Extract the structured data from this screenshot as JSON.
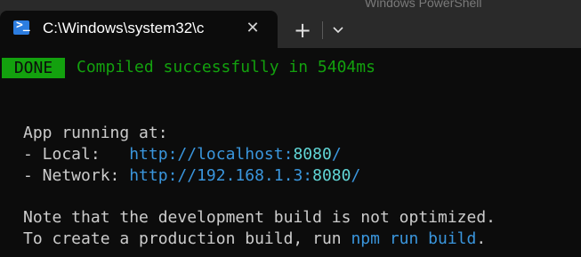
{
  "tab": {
    "title": "C:\\Windows\\system32\\c",
    "icon": "powershell-icon",
    "close_label": "✕"
  },
  "background_window_title": "Windows PowerShell",
  "toolbar": {
    "new_tab_label": "+",
    "dropdown_icon": "chevron-down-icon"
  },
  "terminal": {
    "done_label": "DONE",
    "done_message": "Compiled successfully in 5404ms",
    "app_running": "App running at:",
    "local_label": "- Local:   ",
    "local_url": "http://localhost:",
    "local_port": "8080",
    "local_suffix": "/",
    "network_label": "- Network: ",
    "network_url": "http://192.168.1.3:",
    "network_port": "8080",
    "network_suffix": "/",
    "note_line": "Note that the development build is not optimized.",
    "prod_prefix": "To create a production build, run ",
    "prod_command": "npm run build",
    "prod_suffix": "."
  },
  "colors": {
    "background": "#0c0c0c",
    "tabstrip": "#2a2a2a",
    "green": "#13a10e",
    "blue": "#3a96dd",
    "cyan": "#61d6d6",
    "text": "#cccccc"
  }
}
